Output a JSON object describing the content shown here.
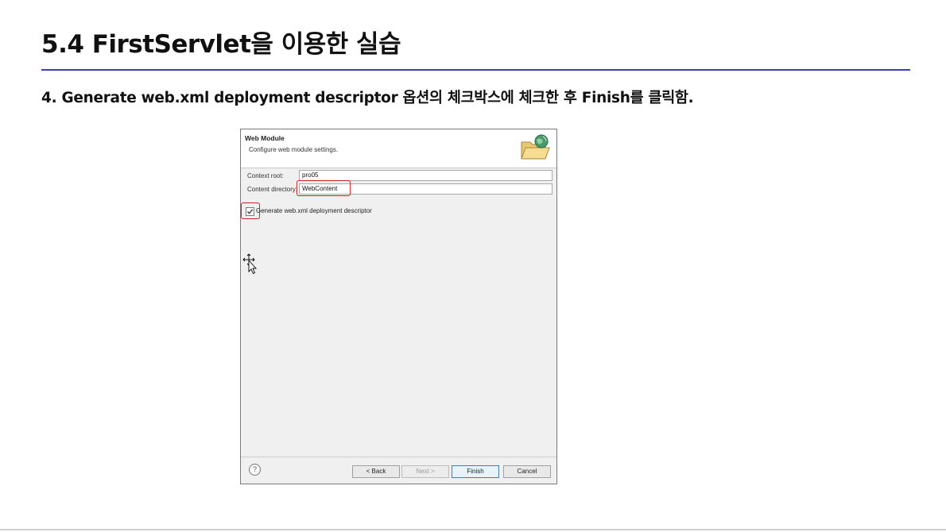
{
  "slide": {
    "title": "5.4 FirstServlet을 이용한 실습",
    "instruction": "4. Generate web.xml deployment descriptor 옵션의 체크박스에 체크한 후 Finish를 클릭함."
  },
  "dialog": {
    "heading": "Web Module",
    "subheading": "Configure web module settings.",
    "context_root_label": "Context root:",
    "context_root_value": "pro05",
    "content_dir_label": "Content directory:",
    "content_dir_value": "WebContent",
    "generate_checkbox_label": "Generate web.xml deployment descriptor",
    "generate_checked": true,
    "buttons": {
      "help": "?",
      "back": "< Back",
      "next": "Next >",
      "finish": "Finish",
      "cancel": "Cancel"
    }
  },
  "colors": {
    "title_rule": "#3b3fbf",
    "highlight": "#d11d1d"
  }
}
